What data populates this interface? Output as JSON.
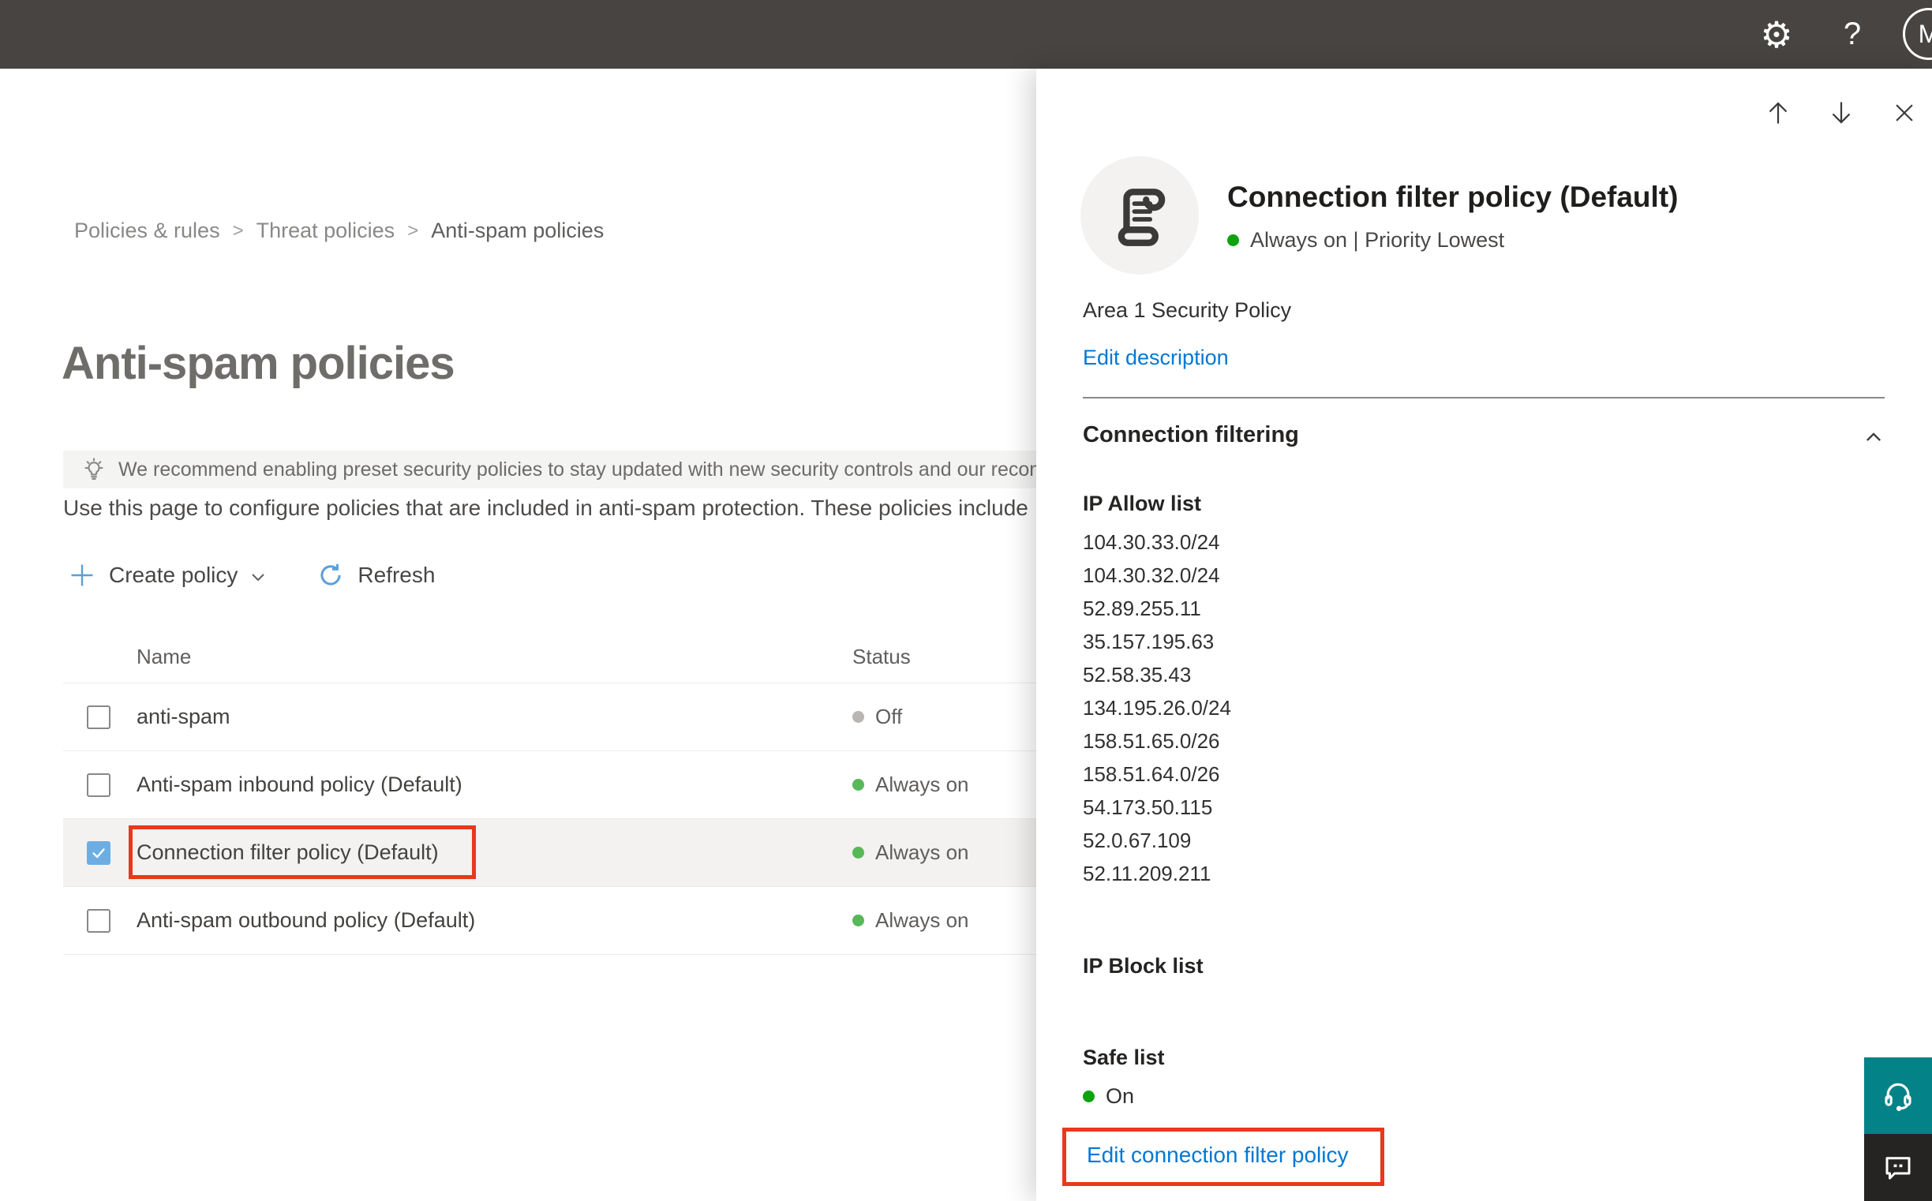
{
  "topbar": {
    "avatar_initial": "M",
    "settings_glyph": "⚙",
    "help_glyph": "?"
  },
  "breadcrumb": {
    "separator": ">",
    "items": [
      "Policies & rules",
      "Threat policies",
      "Anti-spam policies"
    ]
  },
  "page": {
    "title": "Anti-spam policies",
    "banner_text": "We recommend enabling preset security policies to stay updated with new security controls and our recomme",
    "description": "Use this page to configure policies that are included in anti-spam protection. These policies include"
  },
  "toolbar": {
    "create_label": "Create policy",
    "refresh_label": "Refresh"
  },
  "table": {
    "columns": {
      "name": "Name",
      "status": "Status"
    },
    "rows": [
      {
        "name": "anti-spam",
        "status": "Off",
        "status_color": "#b8b5b2",
        "checked": false,
        "selected": false,
        "highlighted": false
      },
      {
        "name": "Anti-spam inbound policy (Default)",
        "status": "Always on",
        "status_color": "#57b857",
        "checked": false,
        "selected": false,
        "highlighted": false
      },
      {
        "name": "Connection filter policy (Default)",
        "status": "Always on",
        "status_color": "#57b857",
        "checked": true,
        "selected": true,
        "highlighted": true
      },
      {
        "name": "Anti-spam outbound policy (Default)",
        "status": "Always on",
        "status_color": "#57b857",
        "checked": false,
        "selected": false,
        "highlighted": false
      }
    ]
  },
  "panel": {
    "title": "Connection filter policy (Default)",
    "status": "Always on | Priority Lowest",
    "description": "Area 1 Security Policy",
    "edit_description_label": "Edit description",
    "section_label": "Connection filtering",
    "ip_allow": {
      "label": "IP Allow list",
      "entries": [
        "104.30.33.0/24",
        "104.30.32.0/24",
        "52.89.255.11",
        "35.157.195.63",
        "52.58.35.43",
        "134.195.26.0/24",
        "158.51.65.0/26",
        "158.51.64.0/26",
        "54.173.50.115",
        "52.0.67.109",
        "52.11.209.211"
      ]
    },
    "ip_block": {
      "label": "IP Block list"
    },
    "safe_list": {
      "label": "Safe list",
      "status": "On"
    },
    "edit_link_label": "Edit connection filter policy"
  },
  "icons": {
    "topbar": [
      "gear-icon",
      "help-icon",
      "avatar"
    ],
    "panel_nav": [
      "arrow-up-icon",
      "arrow-down-icon",
      "close-icon"
    ],
    "banner": "lightbulb-icon",
    "toolbar": [
      "plus-icon",
      "chevron-down-icon",
      "refresh-icon"
    ],
    "panel_header": "policy-scroll-icon",
    "section": "chevron-up-icon",
    "floating": [
      "headset-icon",
      "feedback-icon"
    ]
  },
  "colors": {
    "topbar_bg": "#474442",
    "accent": "#0078d4",
    "icon_blue": "#5b9fd8",
    "green": "#0ea30e",
    "table_green": "#57b857",
    "off_gray": "#b8b5b2",
    "highlight_red": "#e8391b",
    "teal": "#038387",
    "feedback_dark": "#252423",
    "selected_checkbox": "#6caee4"
  }
}
